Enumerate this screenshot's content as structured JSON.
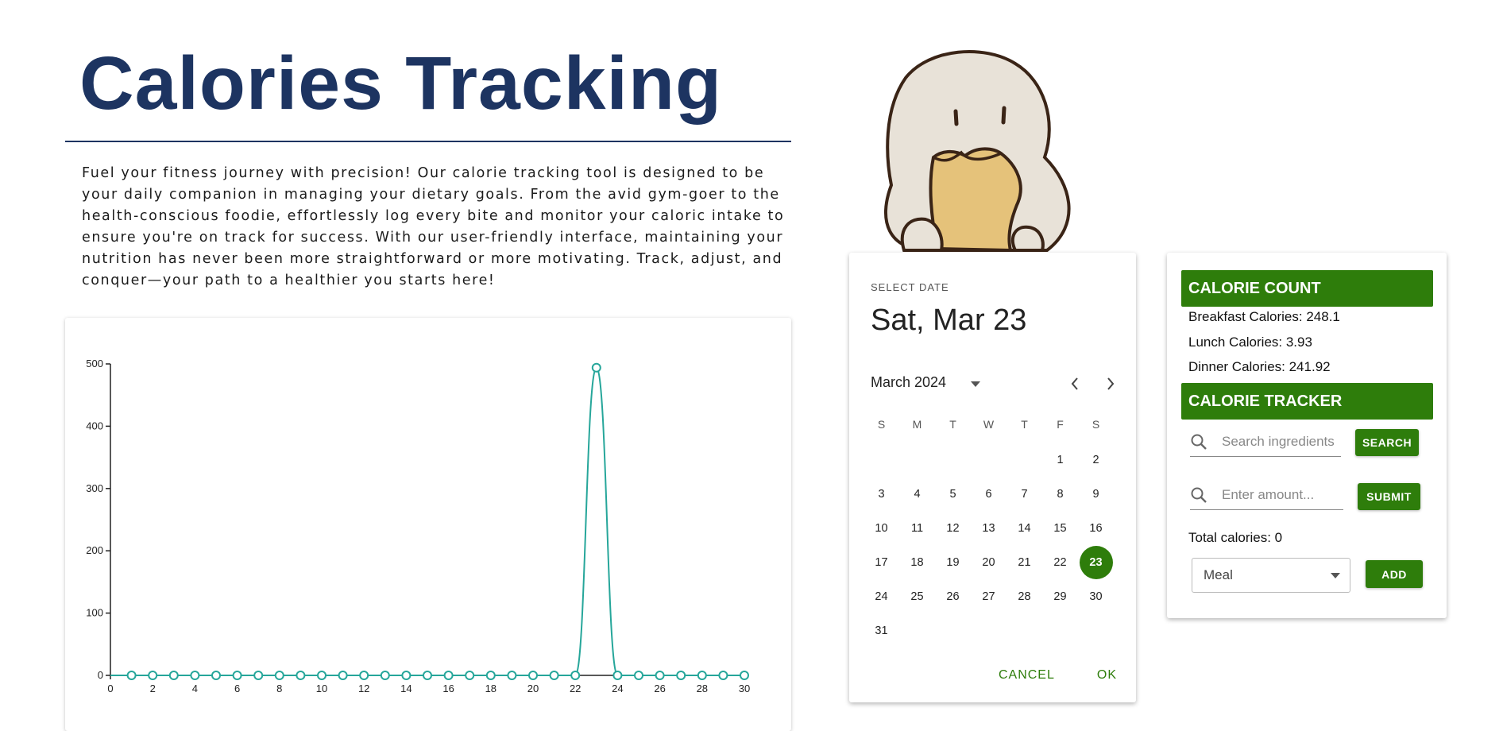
{
  "header": {
    "title": "Calories Tracking",
    "intro": "Fuel your fitness journey with precision! Our calorie tracking tool is designed to be your daily companion in managing your dietary goals. From the avid gym-goer to the health-conscious foodie, effortlessly log every bite and monitor your caloric intake to ensure you're on track for success. With our user-friendly interface, maintaining your nutrition has never been more straightforward or more motivating. Track, adjust, and conquer—your path to a healthier you starts here!"
  },
  "datepicker": {
    "label": "SELECT DATE",
    "selected_date": "Sat, Mar 23",
    "month_year": "March 2024",
    "weekdays": [
      "S",
      "M",
      "T",
      "W",
      "T",
      "F",
      "S"
    ],
    "first_weekday_offset": 5,
    "days_in_month": 31,
    "selected_day": 23,
    "cancel_label": "CANCEL",
    "ok_label": "OK"
  },
  "calorie_count": {
    "title": "CALORIE COUNT",
    "breakfast": "Breakfast Calories: 248.1",
    "lunch": "Lunch Calories: 3.93",
    "dinner": "Dinner Calories: 241.92"
  },
  "calorie_tracker": {
    "title": "CALORIE TRACKER",
    "search_placeholder": "Search ingredients",
    "search_button": "SEARCH",
    "amount_placeholder": "Enter amount...",
    "submit_button": "SUBMIT",
    "total": "Total calories: 0",
    "meal_selected": "Meal",
    "add_button": "ADD"
  },
  "icons": {
    "search": "search-icon",
    "prev": "chevron-left-icon",
    "next": "chevron-right-icon",
    "dropdown": "caret-down-icon"
  },
  "colors": {
    "title": "#1d3461",
    "accent": "#2e7d0b",
    "line": "#26a69a"
  },
  "chart_data": {
    "type": "line",
    "title": "",
    "xlabel": "",
    "ylabel": "",
    "x": [
      0,
      1,
      2,
      3,
      4,
      5,
      6,
      7,
      8,
      9,
      10,
      11,
      12,
      13,
      14,
      15,
      16,
      17,
      18,
      19,
      20,
      21,
      22,
      23,
      24,
      25,
      26,
      27,
      28,
      29,
      30
    ],
    "y": [
      0,
      0,
      0,
      0,
      0,
      0,
      0,
      0,
      0,
      0,
      0,
      0,
      0,
      0,
      0,
      0,
      0,
      0,
      0,
      0,
      0,
      0,
      0,
      493.95,
      0,
      0,
      0,
      0,
      0,
      0,
      0
    ],
    "markers_from_x": 1,
    "xlim": [
      0,
      30
    ],
    "ylim": [
      0,
      500
    ],
    "x_ticks": [
      "0",
      "2",
      "4",
      "6",
      "8",
      "10",
      "12",
      "14",
      "16",
      "18",
      "20",
      "22",
      "24",
      "26",
      "28",
      "30"
    ],
    "y_ticks": [
      "0",
      "100",
      "200",
      "300",
      "400",
      "500"
    ],
    "grid": false,
    "legend": "none"
  }
}
